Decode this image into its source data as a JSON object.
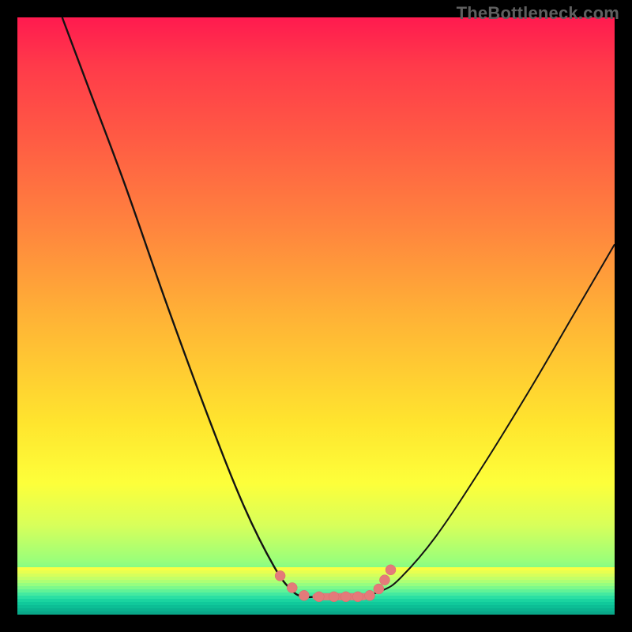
{
  "attribution": "TheBottleneck.com",
  "colors": {
    "background": "#000000",
    "gradient_top": "#ff1a4f",
    "gradient_mid": "#ffe52e",
    "gradient_bottom": "#0ad6a0",
    "curve_stroke": "#131313",
    "marker_fill": "#e47a7a",
    "marker_stroke": "#d76a6a"
  },
  "chart_data": {
    "type": "line",
    "title": "",
    "xlabel": "",
    "ylabel": "",
    "xlim": [
      0,
      100
    ],
    "ylim": [
      0,
      100
    ],
    "grid": false,
    "legend": false,
    "annotations": [],
    "series": [
      {
        "name": "left-branch",
        "x": [
          7.5,
          12,
          18,
          25,
          32,
          38,
          43,
          46,
          48,
          50
        ],
        "values": [
          100,
          88,
          72,
          52,
          33,
          18,
          8,
          4,
          3,
          3
        ]
      },
      {
        "name": "right-branch",
        "x": [
          58,
          61,
          64,
          70,
          78,
          86,
          93,
          100
        ],
        "values": [
          3,
          4,
          6,
          13,
          25,
          38,
          50,
          62
        ]
      },
      {
        "name": "valley-floor",
        "x": [
          50,
          52,
          54,
          56,
          58
        ],
        "values": [
          3,
          3,
          3,
          3,
          3
        ]
      }
    ],
    "markers": [
      {
        "x": 44,
        "y": 6.5
      },
      {
        "x": 46,
        "y": 4.5
      },
      {
        "x": 48,
        "y": 3.2
      },
      {
        "x": 50.5,
        "y": 3
      },
      {
        "x": 53,
        "y": 3
      },
      {
        "x": 55,
        "y": 3
      },
      {
        "x": 57,
        "y": 3
      },
      {
        "x": 59,
        "y": 3.2
      },
      {
        "x": 60.5,
        "y": 4.3
      },
      {
        "x": 61.5,
        "y": 5.8
      },
      {
        "x": 62.5,
        "y": 7.5
      }
    ]
  }
}
